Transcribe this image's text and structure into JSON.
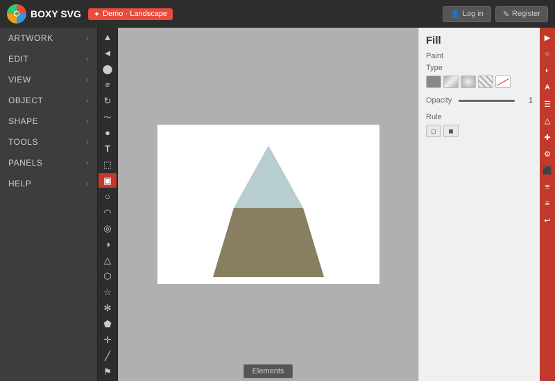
{
  "app": {
    "title": "BOXY SVG",
    "demo_badge": "Demo · Landscape"
  },
  "auth": {
    "login_label": "Log in",
    "register_label": "Register"
  },
  "sidebar": {
    "items": [
      {
        "id": "artwork",
        "label": "Artwork"
      },
      {
        "id": "edit",
        "label": "Edit"
      },
      {
        "id": "view",
        "label": "View"
      },
      {
        "id": "object",
        "label": "Object"
      },
      {
        "id": "shape",
        "label": "Shape"
      },
      {
        "id": "tools",
        "label": "Tools"
      },
      {
        "id": "panels",
        "label": "Panels"
      },
      {
        "id": "help",
        "label": "Help"
      }
    ]
  },
  "fill_panel": {
    "title": "Fill",
    "paint_label": "Paint",
    "type_label": "Type",
    "opacity_label": "Opacity",
    "opacity_value": "1",
    "rule_label": "Rule"
  },
  "bottom": {
    "elements_label": "Elements"
  },
  "tools": [
    {
      "icon": "▲",
      "name": "select-tool",
      "active": false
    },
    {
      "icon": "◄",
      "name": "direct-select-tool",
      "active": false
    },
    {
      "icon": "⬤",
      "name": "node-tool",
      "active": false
    },
    {
      "icon": "⌀",
      "name": "smooth-tool",
      "active": false
    },
    {
      "icon": "⟳",
      "name": "rotate-tool",
      "active": false
    },
    {
      "icon": "〜",
      "name": "pen-tool",
      "active": false
    },
    {
      "icon": "●",
      "name": "blob-tool",
      "active": false
    },
    {
      "icon": "T",
      "name": "text-tool",
      "active": false
    },
    {
      "icon": "⬚",
      "name": "frame-tool",
      "active": false
    },
    {
      "icon": "▣",
      "name": "rect-tool",
      "active": true
    },
    {
      "icon": "○",
      "name": "circle-tool",
      "active": false
    },
    {
      "icon": "◠",
      "name": "ellipse-tool",
      "active": false
    },
    {
      "icon": "◎",
      "name": "ring-tool",
      "active": false
    },
    {
      "icon": "◑",
      "name": "moon-tool",
      "active": false
    },
    {
      "icon": "△",
      "name": "triangle-tool",
      "active": false
    },
    {
      "icon": "⬡",
      "name": "polygon-tool",
      "active": false
    },
    {
      "icon": "☆",
      "name": "star-tool",
      "active": false
    },
    {
      "icon": "✻",
      "name": "burst-tool",
      "active": false
    },
    {
      "icon": "⬟",
      "name": "arrow-tool",
      "active": false
    },
    {
      "icon": "✛",
      "name": "cross-tool",
      "active": false
    },
    {
      "icon": "╱",
      "name": "line-tool",
      "active": false
    },
    {
      "icon": "⚑",
      "name": "flag-tool",
      "active": false
    }
  ],
  "far_right_icons": [
    "▶",
    "○",
    "◐",
    "A",
    "☰",
    "▲",
    "✚",
    "⚙",
    "⬛",
    "≡",
    "≡",
    "↩"
  ]
}
